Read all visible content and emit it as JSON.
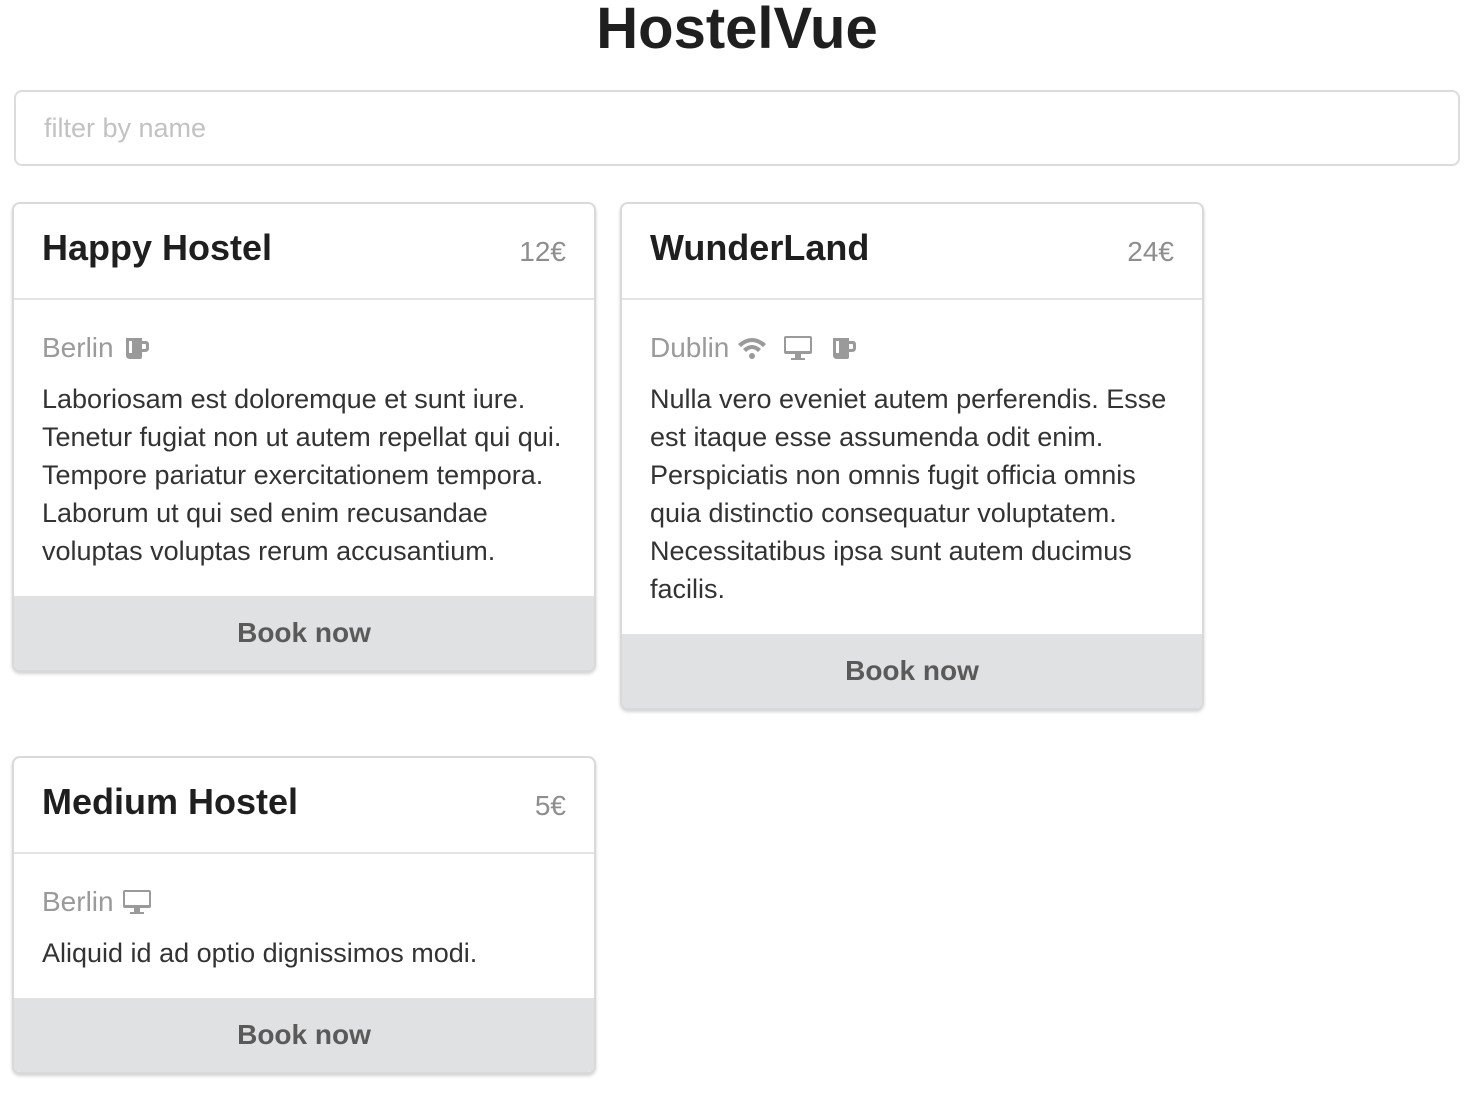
{
  "app": {
    "title": "HostelVue"
  },
  "search": {
    "placeholder": "filter by name",
    "value": ""
  },
  "colors": {
    "muted_text": "#9a9a9a",
    "button_bg": "#e0e1e2",
    "border": "#d9d9d9"
  },
  "hostels": [
    {
      "name": "Happy Hostel",
      "price": "12€",
      "city": "Berlin",
      "amenities": [
        "coffee-icon"
      ],
      "description": "Laboriosam est doloremque et sunt iure. Tenetur fugiat non ut autem repellat qui qui. Tempore pariatur exercitationem tempora. Laborum ut qui sed enim recusandae voluptas voluptas rerum accusantium.",
      "button_label": "Book now"
    },
    {
      "name": "WunderLand",
      "price": "24€",
      "city": "Dublin",
      "amenities": [
        "wifi-icon",
        "desktop-icon",
        "coffee-icon"
      ],
      "description": "Nulla vero eveniet autem perferendis. Esse est itaque esse assumenda odit enim. Perspiciatis non omnis fugit officia omnis quia distinctio consequatur voluptatem. Necessitatibus ipsa sunt autem ducimus facilis.",
      "button_label": "Book now"
    },
    {
      "name": "Medium Hostel",
      "price": "5€",
      "city": "Berlin",
      "amenities": [
        "desktop-icon"
      ],
      "description": "Aliquid id ad optio dignissimos modi.",
      "button_label": "Book now"
    }
  ]
}
